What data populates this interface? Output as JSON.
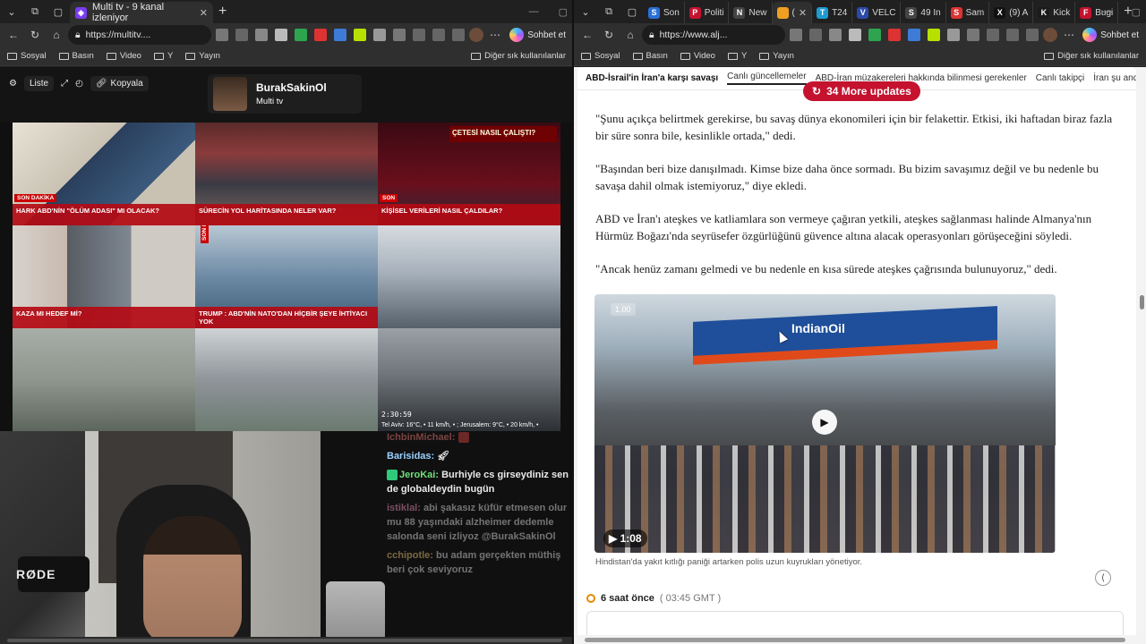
{
  "left_window": {
    "tab": {
      "title": "Multi tv - 9 kanal izleniyor"
    },
    "address": {
      "url": "https://multitv...."
    },
    "chat_button": "Sohbet et",
    "bookmarks": [
      "Sosyal",
      "Basın",
      "Video",
      "Y",
      "Yayın"
    ],
    "other_bookmarks": "Diğer sık kullanılanlar",
    "multitv": {
      "buttons": {
        "list": "Liste",
        "copy": "Kopyala"
      },
      "channel": {
        "name": "BurakSakinOl",
        "sub": "Multi tv"
      },
      "tiles": [
        {
          "lower_third": "HARK ABD'NİN \"ÖLÜM ADASI\" MI OLACAK?",
          "tag": "SON DAKİKA"
        },
        {
          "lower_third": "SÜRECİN YOL HARİTASINDA NELER VAR?",
          "tag": ""
        },
        {
          "lower_third": "KİŞİSEL VERİLERİ NASIL ÇALDILAR?",
          "tag": "SON",
          "panel_title": "ÇETESİ NASIL ÇALIŞTI?"
        },
        {
          "lower_third": "KAZA MI HEDEF Mİ?",
          "tag": ""
        },
        {
          "lower_third": "TRUMP : ABD'NİN NATO'DAN HİÇBİR ŞEYE İHTİYACI YOK",
          "tag": "SON DAKİKA"
        },
        {
          "lower_third": "",
          "tag": ""
        },
        {
          "lower_third": "",
          "tag": ""
        },
        {
          "lower_third": "",
          "tag": ""
        },
        {
          "clock": "2:30:59",
          "weather": "Tel Aviv: 16°C, • 11 km/h, • ; Jerusalem: 9°C, • 20 km/h, •"
        }
      ]
    },
    "webcam_label": "RØDE",
    "chat": [
      {
        "user": "IchbinMichael:",
        "text": "",
        "dim": true,
        "color": "red"
      },
      {
        "user": "Barisidas:",
        "text": "",
        "dim": false,
        "color": "blue"
      },
      {
        "user": "JeroKai:",
        "text": "Burhiyle cs girseydiniz sen de globaldeydin bugün",
        "dim": false,
        "color": "green"
      },
      {
        "user": "istiklal:",
        "text": "abi şakasız küfür etmesen olur mu 88 yaşındaki alzheimer dedemle salonda seni izliyoz @BurakSakinOl",
        "dim": true,
        "color": "pink"
      },
      {
        "user": "cchipotle:",
        "text": "bu adam gerçekten müthiş beri çok seviyoruz",
        "dim": true,
        "color": "yellow"
      }
    ]
  },
  "right_window": {
    "tabs": [
      {
        "label": "Son",
        "color": "#2a6fd6",
        "glyph": "S"
      },
      {
        "label": "Politi",
        "color": "#c4122f",
        "glyph": "P"
      },
      {
        "label": "New",
        "color": "#444444",
        "glyph": "N"
      },
      {
        "label": "(",
        "color": "#f0a020",
        "glyph": ""
      },
      {
        "label": "T24",
        "color": "#1d9bd1",
        "glyph": "T"
      },
      {
        "label": "VELC",
        "color": "#2b4aa8",
        "glyph": "V"
      },
      {
        "label": "49 In",
        "color": "#444444",
        "glyph": "S"
      },
      {
        "label": "Sam",
        "color": "#d33",
        "glyph": "S"
      },
      {
        "label": "(9) A",
        "color": "#111111",
        "glyph": "X"
      },
      {
        "label": "Kick",
        "color": "#1b1b1b",
        "glyph": "K"
      },
      {
        "label": "Bugi",
        "color": "#c4122f",
        "glyph": "F"
      }
    ],
    "address": {
      "url": "https://www.alj..."
    },
    "chat_button": "Sohbet et",
    "bookmarks": [
      "Sosyal",
      "Basın",
      "Video",
      "Y",
      "Yayın"
    ],
    "other_bookmarks": "Diğer sık kullanılanlar",
    "article": {
      "subnav": {
        "title": "ABD-İsrail'in İran'a karşı savaşı",
        "items": [
          "Canlı güncellemeler",
          "ABD-İran müzakereleri hakkında bilinmesi gerekenler",
          "Canlı takipçi",
          "İran şu anda dah"
        ]
      },
      "more_updates": "34 More updates",
      "paragraphs": [
        "\"Şunu açıkça belirtmek gerekirse, bu savaş dünya ekonomileri için bir felakettir. Etkisi, iki haftadan biraz fazla bir süre sonra bile, kesinlikle ortada,\" dedi.",
        "\"Başından beri bize danışılmadı. Kimse bize daha önce sormadı. Bu bizim savaşımız değil ve bu nedenle bu savaşa dahil olmak istemiyoruz,\" diye ekledi.",
        "ABD ve İran'ı ateşkes ve katliamlara son vermeye çağıran yetkili, ateşkes sağlanması halinde Almanya'nın Hürmüz Boğazı'nda seyrüsefer özgürlüğünü güvence altına alacak operasyonları görüşeceğini söyledi.",
        "\"Ancak henüz zamanı gelmedi ve bu nedenle en kısa sürede ateşkes çağrısında bulunuyoruz,\" dedi."
      ],
      "video": {
        "duration": "1:08",
        "speed": "1.00",
        "brand": "IndianOil"
      },
      "caption": "Hindistan'da yakıt kıtlığı paniği artarken polis uzun kuyrukları yönetiyor.",
      "time_ago": "6 saat önce",
      "time_gmt": "( 03:45 GMT )"
    }
  },
  "colors": {
    "accent_red": "#c4122f",
    "dark_chrome": "#202020",
    "toolbar": "#2f2f2f"
  }
}
